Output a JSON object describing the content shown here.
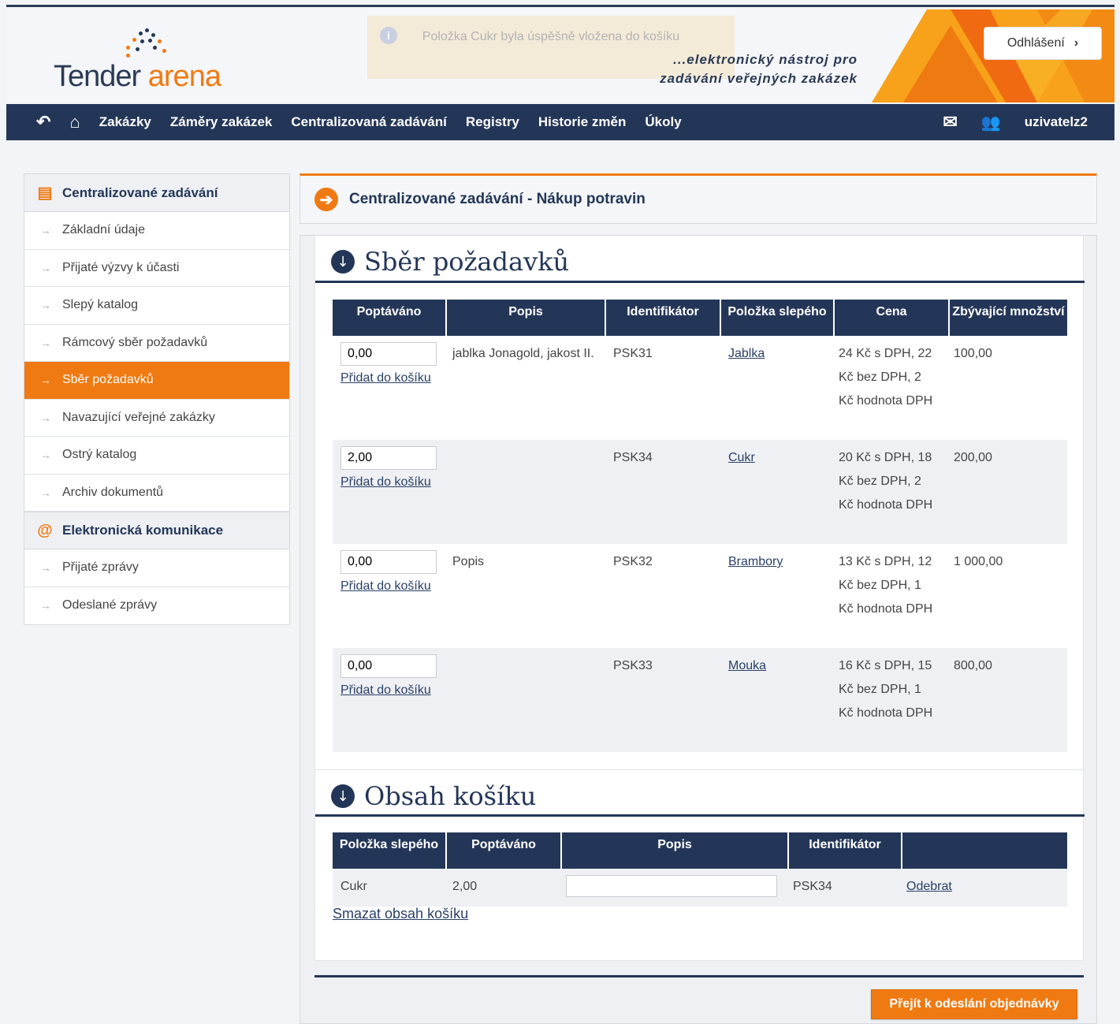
{
  "header": {
    "logo_word1": "Tender",
    "logo_word2": "arena",
    "notice": "Položka Cukr byla úspěšně vložena do košíku",
    "tagline_line1": "...elektronický nástroj pro",
    "tagline_line2": "zadávání veřejných zakázek",
    "logout_label": "Odhlášení"
  },
  "navbar": {
    "items": [
      "Zakázky",
      "Záměry zakázek",
      "Centralizovaná zadávání",
      "Registry",
      "Historie změn",
      "Úkoly"
    ],
    "username": "uzivatelz2"
  },
  "sidebar": {
    "group1_title": "Centralizované zadávání",
    "group1_items": [
      "Základní údaje",
      "Přijaté výzvy k účasti",
      "Slepý katalog",
      "Rámcový sběr požadavků",
      "Sběr požadavků",
      "Navazující veřejné zakázky",
      "Ostrý katalog",
      "Archiv dokumentů"
    ],
    "active_item": "Sběr požadavků",
    "group2_title": "Elektronická komunikace",
    "group2_items": [
      "Přijaté zprávy",
      "Odeslané zprávy"
    ]
  },
  "page_title": "Centralizované zadávání - Nákup potravin",
  "requests": {
    "title": "Sběr požadavků",
    "columns": [
      "Poptáváno",
      "Popis",
      "Identifikátor",
      "Položka slepého",
      "Cena",
      "Zbývající množství"
    ],
    "add_label": "Přidat do košíku",
    "rows": [
      {
        "qty": "0,00",
        "desc": "jablka Jonagold, jakost II.",
        "id": "PSK31",
        "item": "Jablka",
        "price": "24 Kč s DPH, 22 Kč bez DPH, 2 Kč hodnota DPH",
        "remaining": "100,00"
      },
      {
        "qty": "2,00",
        "desc": "",
        "id": "PSK34",
        "item": "Cukr",
        "price": "20 Kč s DPH, 18 Kč bez DPH, 2 Kč hodnota DPH",
        "remaining": "200,00"
      },
      {
        "qty": "0,00",
        "desc": "Popis",
        "id": "PSK32",
        "item": "Brambory",
        "price": "13 Kč s DPH, 12 Kč bez DPH, 1 Kč hodnota DPH",
        "remaining": "1 000,00"
      },
      {
        "qty": "0,00",
        "desc": "",
        "id": "PSK33",
        "item": "Mouka",
        "price": "16 Kč s DPH, 15 Kč bez DPH, 1 Kč hodnota DPH",
        "remaining": "800,00"
      }
    ]
  },
  "cart": {
    "title": "Obsah košíku",
    "columns": [
      "Položka slepého",
      "Poptáváno",
      "Popis",
      "Identifikátor",
      ""
    ],
    "rows": [
      {
        "item": "Cukr",
        "qty": "2,00",
        "desc_value": "",
        "id": "PSK34",
        "remove_label": "Odebrat"
      }
    ],
    "clear_label": "Smazat obsah košíku"
  },
  "submit_label": "Přejít k odeslání objednávky",
  "colors": {
    "primary": "#243658",
    "accent": "#f07a12",
    "background": "#f2f4f7"
  }
}
